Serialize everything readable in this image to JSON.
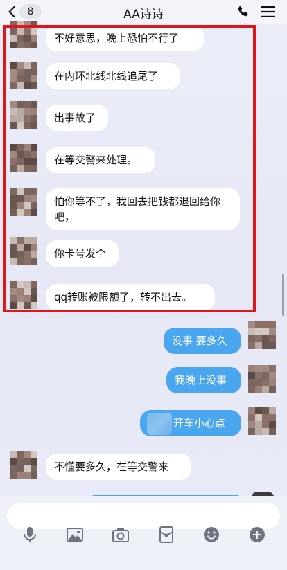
{
  "header": {
    "back_label": "<",
    "unread_count": "8",
    "title": "AA诗诗"
  },
  "messages": [
    {
      "text": "不好意思，晚上恐怕不行了",
      "side": "in"
    },
    {
      "text": "在内环北线北线追尾了",
      "side": "in"
    },
    {
      "text": "出事故了",
      "side": "in"
    },
    {
      "text": "在等交警来处理。",
      "side": "in"
    },
    {
      "text": "怕你等不了，我回去把钱都退回给你吧，",
      "side": "in"
    },
    {
      "text": "你卡号发个",
      "side": "in"
    },
    {
      "text": "qq转账被限额了，转不出去。",
      "side": "in"
    },
    {
      "text": "没事 要多久",
      "side": "out"
    },
    {
      "text": "我晚上没事",
      "side": "out"
    },
    {
      "text": "开车小心点",
      "side": "out"
    },
    {
      "text": "不懂要多久，在等交警来",
      "side": "in"
    }
  ],
  "input": {
    "placeholder": ""
  },
  "toolbar": [
    "microphone-icon",
    "image-icon",
    "camera-icon",
    "red-packet-icon",
    "emoji-icon",
    "plus-icon"
  ],
  "colors": {
    "highlight": "#e0161b",
    "outgoing_bubble": "#4aa6ee",
    "incoming_bubble": "#ffffff"
  }
}
